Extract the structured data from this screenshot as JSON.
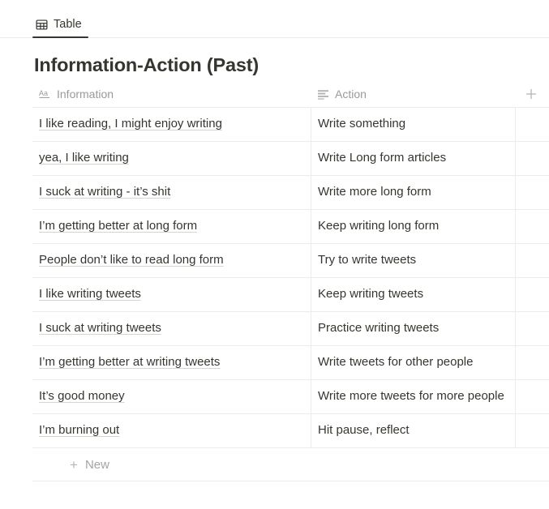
{
  "view": {
    "tabs": [
      {
        "label": "Table",
        "icon": "table-icon",
        "active": true
      }
    ]
  },
  "database": {
    "title": "Information-Action (Past)",
    "columns": [
      {
        "name": "Information",
        "icon": "title-aa-icon",
        "type": "title"
      },
      {
        "name": "Action",
        "icon": "text-lines-icon",
        "type": "text"
      }
    ],
    "add_column_label": "+",
    "rows": [
      {
        "information": "I like reading, I might enjoy writing",
        "action": "Write something"
      },
      {
        "information": "yea, I like writing",
        "action": "Write Long form articles"
      },
      {
        "information": "I suck at writing - it’s shit",
        "action": "Write more long form"
      },
      {
        "information": "I’m getting better at long form",
        "action": "Keep writing long form"
      },
      {
        "information": "People don’t like to read long form",
        "action": "Try to write tweets"
      },
      {
        "information": "I like writing tweets",
        "action": "Keep writing tweets"
      },
      {
        "information": "I suck at writing tweets",
        "action": "Practice writing tweets"
      },
      {
        "information": "I’m getting better at writing tweets",
        "action": "Write tweets for other people"
      },
      {
        "information": "It’s good money",
        "action": "Write more tweets for more people"
      },
      {
        "information": "I’m burning out",
        "action": "Hit pause, reflect"
      }
    ],
    "new_row_label": "New",
    "new_row_icon": "plus-icon"
  },
  "colors": {
    "text": "#37352f",
    "muted": "#9b9a97",
    "border": "#ececeb",
    "underline": "#d6d5d3",
    "background": "#ffffff"
  }
}
